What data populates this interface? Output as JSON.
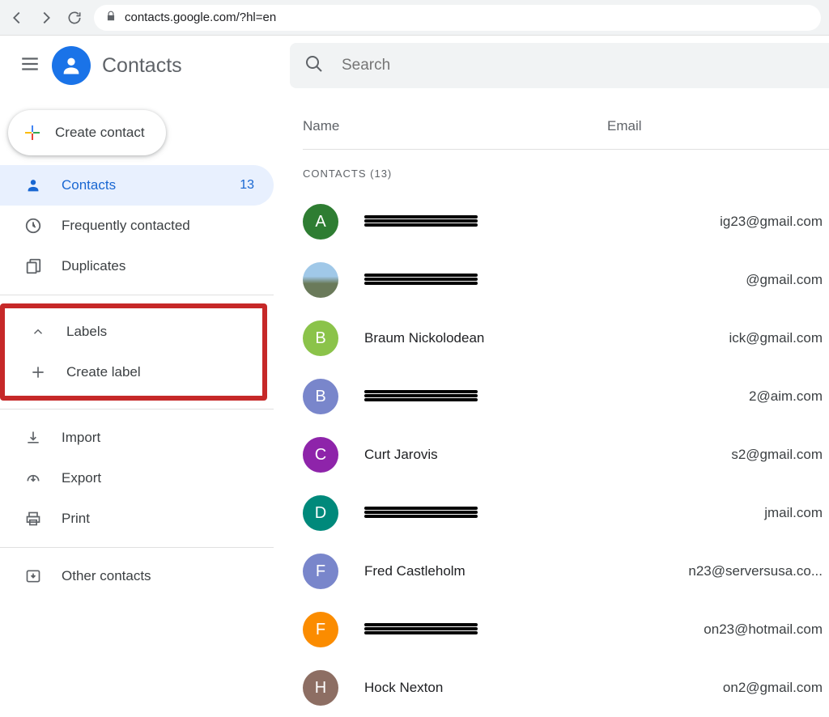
{
  "browser": {
    "url": "contacts.google.com/?hl=en"
  },
  "header": {
    "app_title": "Contacts",
    "search_placeholder": "Search"
  },
  "sidebar": {
    "create_label": "Create contact",
    "nav": {
      "contacts": "Contacts",
      "contacts_count": "13",
      "frequently": "Frequently contacted",
      "duplicates": "Duplicates",
      "labels": "Labels",
      "create_label": "Create label",
      "import": "Import",
      "export": "Export",
      "print": "Print",
      "other": "Other contacts"
    }
  },
  "main": {
    "col_name": "Name",
    "col_email": "Email",
    "section_label": "CONTACTS (13)",
    "rows": [
      {
        "letter": "A",
        "color": "#2e7d32",
        "name": "",
        "redacted": true,
        "email": "ig23@gmail.com"
      },
      {
        "letter": "",
        "color": "photo",
        "name": "",
        "redacted": true,
        "email": "@gmail.com"
      },
      {
        "letter": "B",
        "color": "#8bc34a",
        "name": "Braum Nickolodean",
        "redacted": false,
        "email": "ick@gmail.com"
      },
      {
        "letter": "B",
        "color": "#7986cb",
        "name": "",
        "redacted": true,
        "email": "2@aim.com"
      },
      {
        "letter": "C",
        "color": "#8e24aa",
        "name": "Curt Jarovis",
        "redacted": false,
        "email": "s2@gmail.com"
      },
      {
        "letter": "D",
        "color": "#00897b",
        "name": "",
        "redacted": true,
        "email": "jmail.com"
      },
      {
        "letter": "F",
        "color": "#7986cb",
        "name": "Fred Castleholm",
        "redacted": false,
        "email": "n23@serversusa.co..."
      },
      {
        "letter": "F",
        "color": "#fb8c00",
        "name": "",
        "redacted": true,
        "email": "on23@hotmail.com"
      },
      {
        "letter": "H",
        "color": "#8d6e63",
        "name": "Hock Nexton",
        "redacted": false,
        "email": "on2@gmail.com"
      }
    ]
  }
}
